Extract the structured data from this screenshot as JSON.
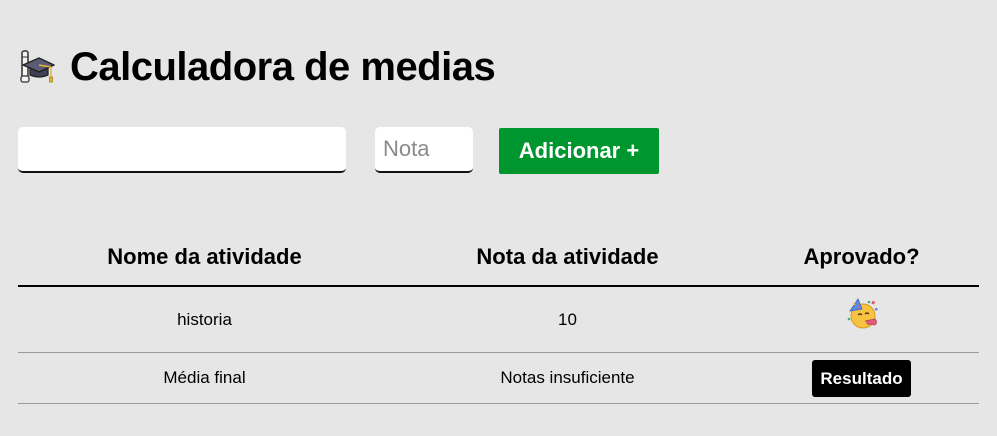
{
  "header": {
    "icon": "graduation-cap-icon",
    "title": "Calculadora de medias"
  },
  "form": {
    "activity_name_value": "",
    "grade_placeholder": "Nota",
    "add_button_label": "Adicionar +"
  },
  "table": {
    "headers": [
      "Nome da atividade",
      "Nota da atividade",
      "Aprovado?"
    ],
    "rows": [
      {
        "name": "historia",
        "grade": "10",
        "approved_icon": "party-face-icon"
      }
    ],
    "final": {
      "label": "Média final",
      "value": "Notas insuficiente",
      "result_label": "Resultado"
    }
  },
  "colors": {
    "background": "#e6e6e6",
    "accent": "#00962f",
    "result_badge": "#000000"
  }
}
